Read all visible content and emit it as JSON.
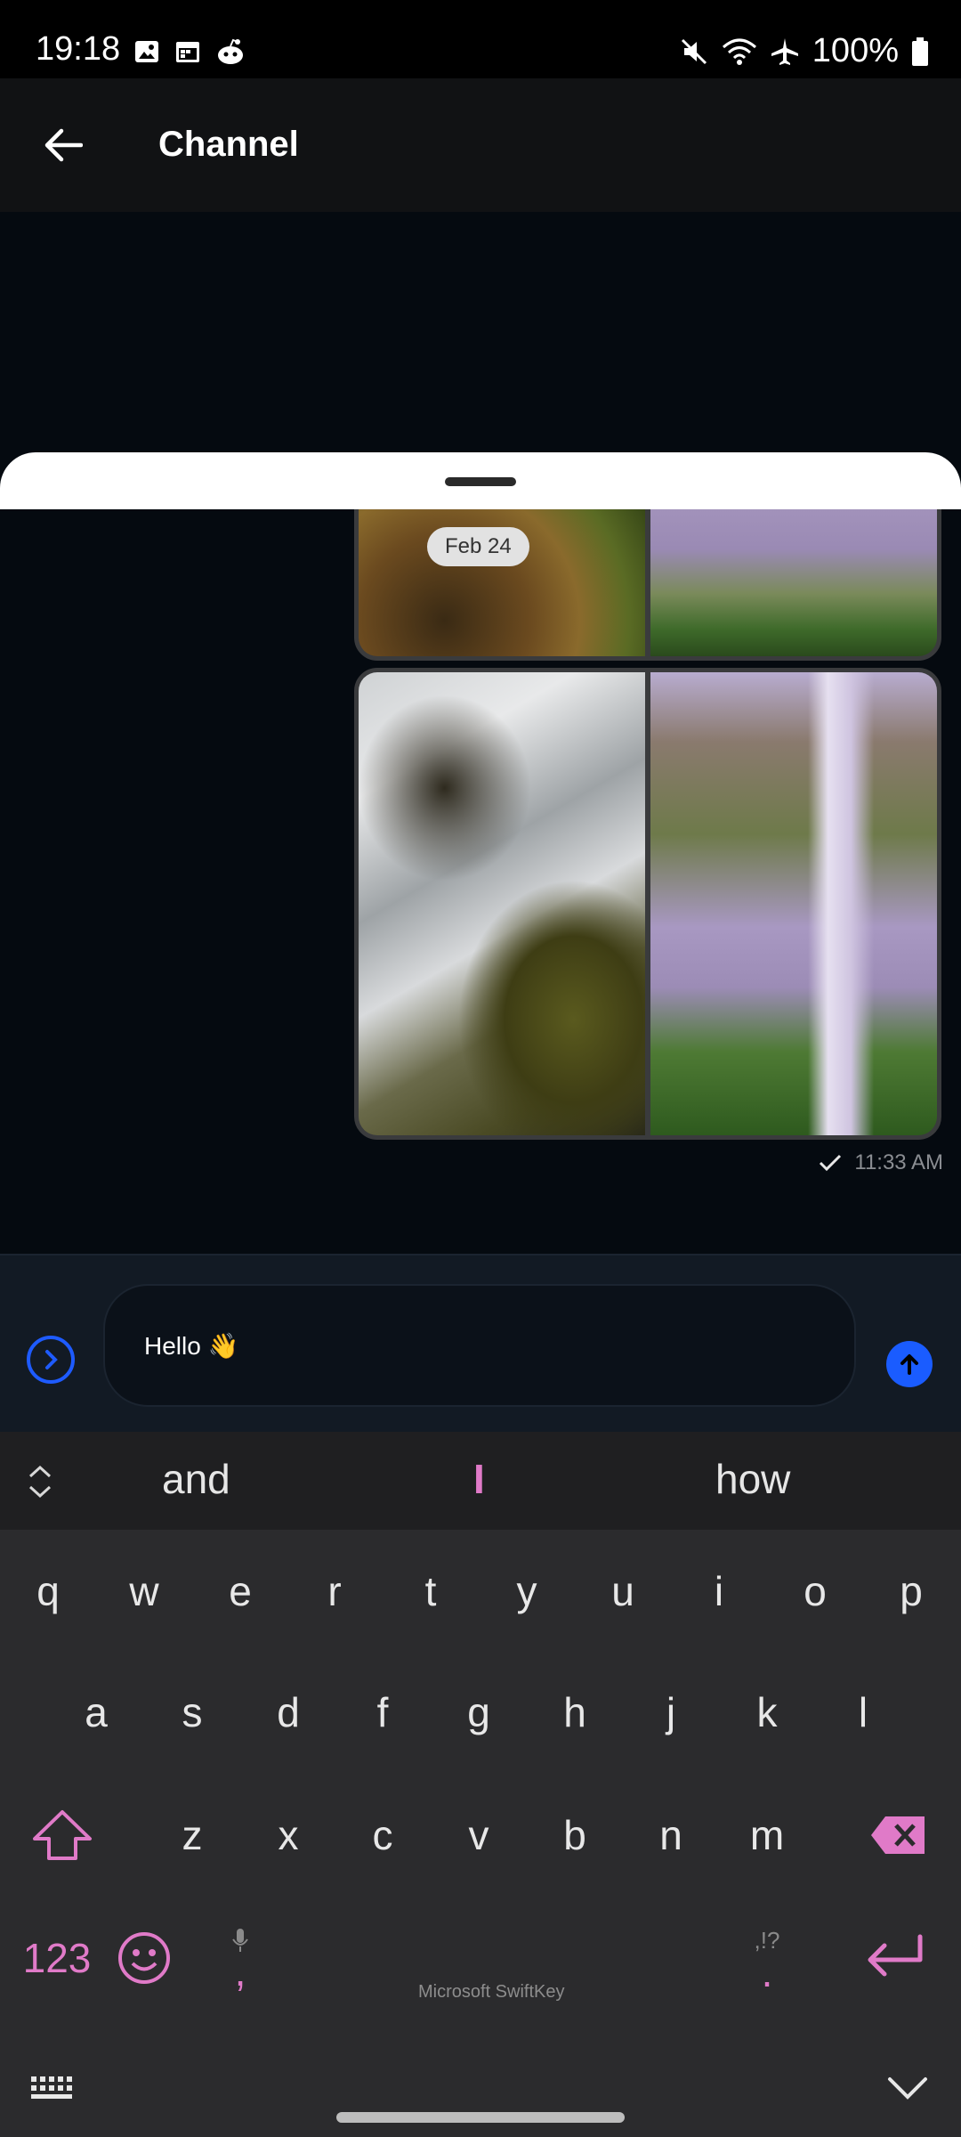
{
  "status_bar": {
    "time": "19:18",
    "battery": "100%",
    "left_icons": [
      "gallery-icon",
      "calendar-icon",
      "reddit-icon"
    ],
    "right_icons": [
      "mute-icon",
      "wifi-icon",
      "airplane-icon",
      "battery-icon"
    ]
  },
  "app_bar": {
    "title": "Channel",
    "back_icon": "arrow-left-icon"
  },
  "messages": {
    "date_chip": "Feb 24",
    "last_time": "11:33 AM",
    "status_icon": "check-icon"
  },
  "composer": {
    "value": "Hello 👋",
    "expand_icon": "chevron-right-circle-icon",
    "send_icon": "arrow-up-icon"
  },
  "keyboard": {
    "suggestions": [
      "and",
      "I",
      "how"
    ],
    "row1": [
      "q",
      "w",
      "e",
      "r",
      "t",
      "y",
      "u",
      "i",
      "o",
      "p"
    ],
    "row2": [
      "a",
      "s",
      "d",
      "f",
      "g",
      "h",
      "j",
      "k",
      "l"
    ],
    "row3": [
      "z",
      "x",
      "c",
      "v",
      "b",
      "n",
      "m"
    ],
    "numbers_key": "123",
    "comma_key": ",",
    "period_key": ".",
    "period_hint": ",!?",
    "brand": "Microsoft SwiftKey",
    "accent_color": "#e07ac8"
  }
}
